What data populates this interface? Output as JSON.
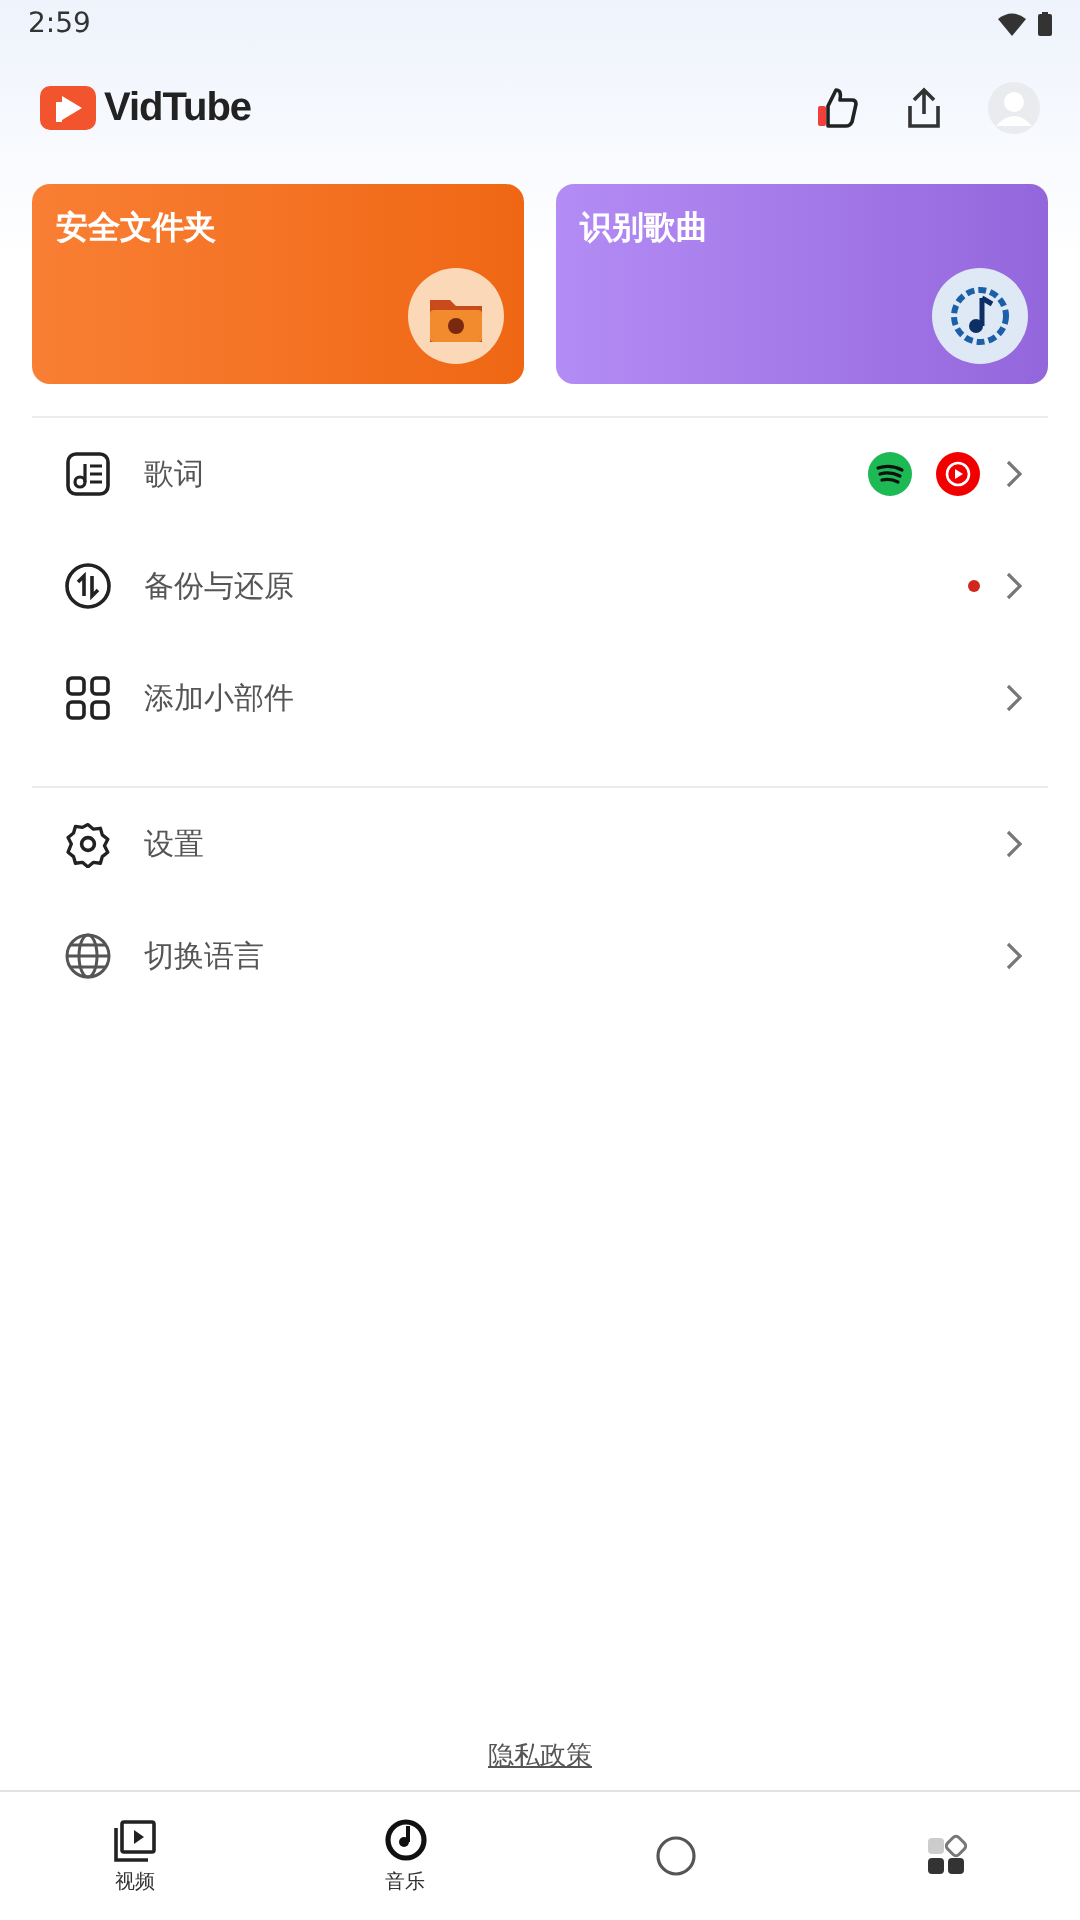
{
  "status_bar": {
    "time": "2:59"
  },
  "header": {
    "app_name": "VidTube"
  },
  "cards": [
    {
      "kind": "vault",
      "title": "安全文件夹"
    },
    {
      "kind": "recognize",
      "title": "识别歌曲"
    }
  ],
  "menu_groups": [
    [
      {
        "kind": "lyrics",
        "label": "歌词",
        "services": true,
        "dot": false
      },
      {
        "kind": "backup",
        "label": "备份与还原",
        "services": false,
        "dot": true
      },
      {
        "kind": "widget",
        "label": "添加小部件",
        "services": false,
        "dot": false
      }
    ],
    [
      {
        "kind": "settings",
        "label": "设置",
        "services": false,
        "dot": false
      },
      {
        "kind": "language",
        "label": "切换语言",
        "services": false,
        "dot": false
      }
    ]
  ],
  "privacy_link": "隐私政策",
  "bottom_nav": [
    {
      "kind": "video",
      "label": "视频"
    },
    {
      "kind": "music",
      "label": "音乐"
    },
    {
      "kind": "discover"
    },
    {
      "kind": "me"
    }
  ]
}
